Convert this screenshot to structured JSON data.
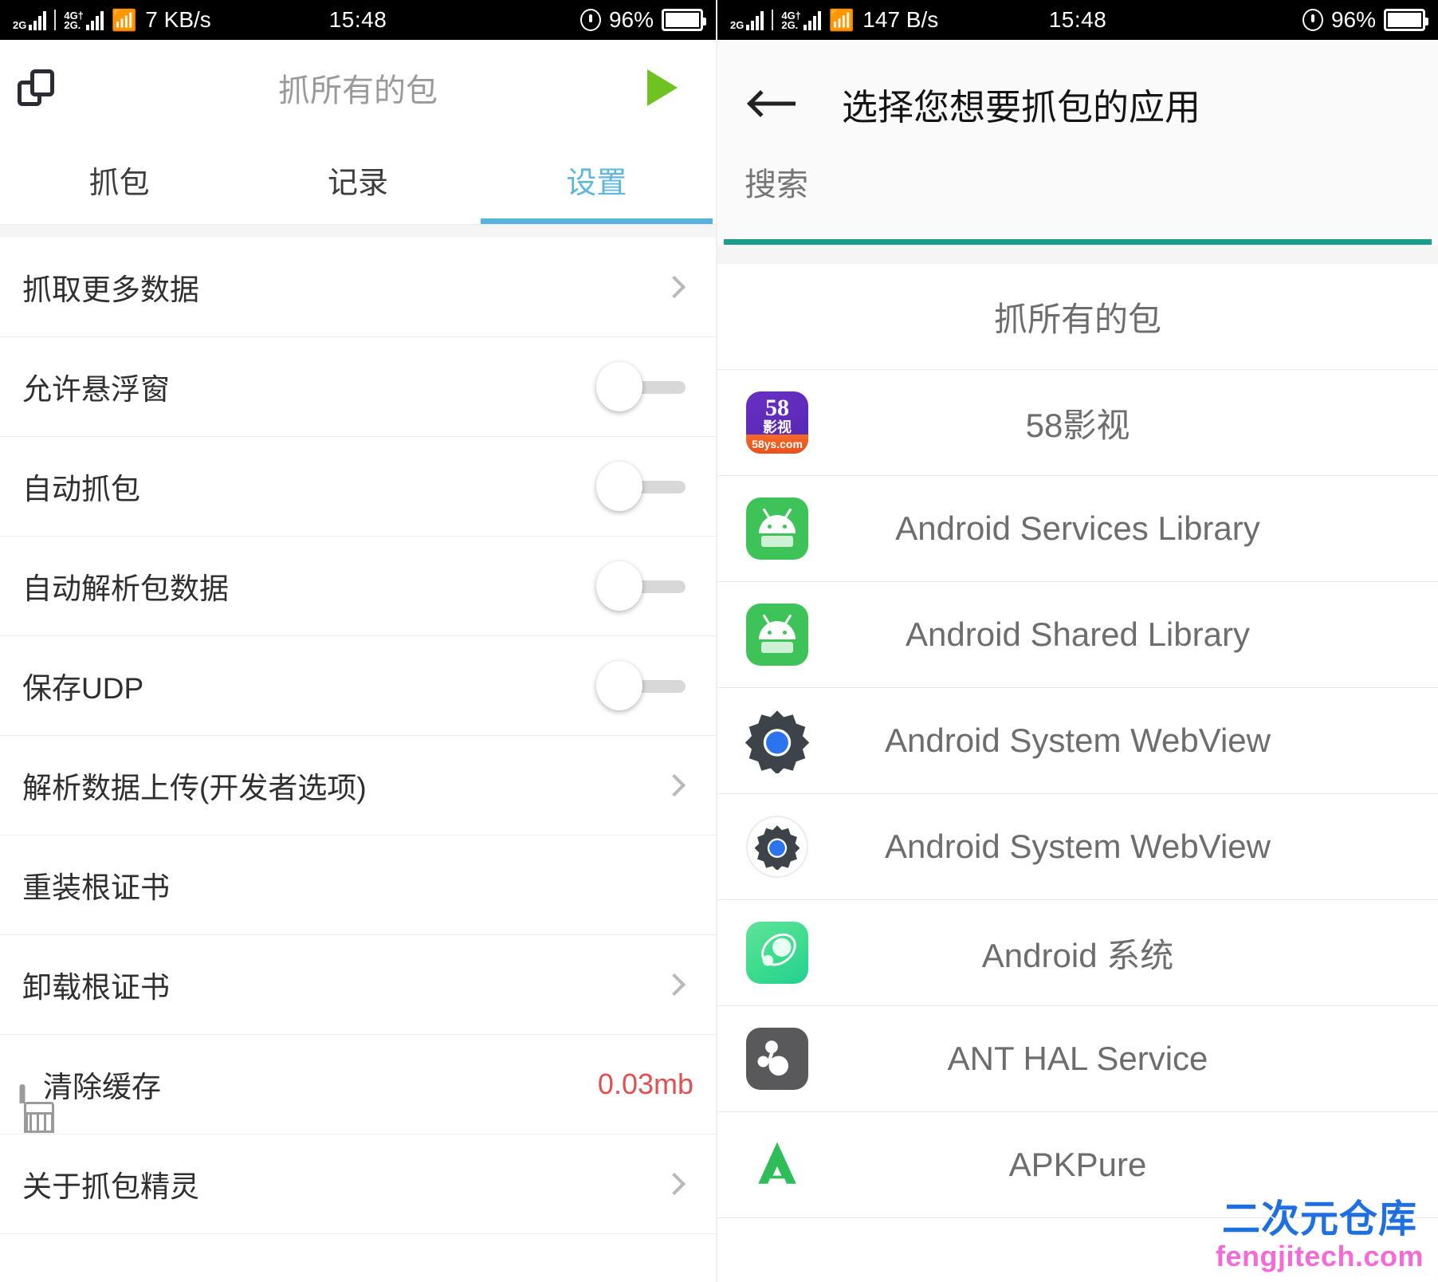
{
  "status_bar": {
    "left": {
      "sim1_label_top": "2G",
      "sim2_label_top": "4G†",
      "sim2_label_bot": "2G.",
      "wifi_icon": "wifi-icon",
      "net_speed": "7 KB/s",
      "time": "15:48",
      "battery_percent": "96%",
      "lock_icon": "rotation-lock-icon"
    },
    "right": {
      "sim1_label_top": "2G",
      "sim2_label_top": "4G†",
      "sim2_label_bot": "2G.",
      "wifi_icon": "wifi-icon",
      "net_speed": "147 B/s",
      "time": "15:48",
      "battery_percent": "96%",
      "lock_icon": "rotation-lock-icon"
    }
  },
  "left_panel": {
    "appbar": {
      "copy_icon": "copy-icon",
      "title": "抓所有的包",
      "play_icon": "play-icon",
      "play_color": "#6ec322"
    },
    "tabs": [
      {
        "label": "抓包",
        "active": false
      },
      {
        "label": "记录",
        "active": false
      },
      {
        "label": "设置",
        "active": true
      }
    ],
    "tab_active_color": "#55b3dd",
    "settings": [
      {
        "label": "抓取更多数据",
        "right": "chevron",
        "icon": null
      },
      {
        "label": "允许悬浮窗",
        "right": "toggle-off",
        "icon": null
      },
      {
        "label": "自动抓包",
        "right": "toggle-off",
        "icon": null
      },
      {
        "label": "自动解析包数据",
        "right": "toggle-off",
        "icon": null
      },
      {
        "label": "保存UDP",
        "right": "toggle-off",
        "icon": null
      },
      {
        "label": "解析数据上传(开发者选项)",
        "right": "chevron",
        "icon": null
      },
      {
        "label": "重装根证书",
        "right": "none",
        "icon": null
      },
      {
        "label": "卸载根证书",
        "right": "chevron",
        "icon": null
      },
      {
        "label": "清除缓存",
        "right": "value",
        "value": "0.03mb",
        "value_color": "#e05050",
        "icon": "brush-icon"
      },
      {
        "label": "关于抓包精灵",
        "right": "chevron",
        "icon": null
      }
    ]
  },
  "right_panel": {
    "appbar": {
      "back_icon": "back-arrow-icon",
      "title": "选择您想要抓包的应用"
    },
    "search": {
      "value": "",
      "placeholder": "搜索",
      "underline_color": "#1a9c88"
    },
    "apps": [
      {
        "name": "抓所有的包",
        "icon": "none"
      },
      {
        "name": "58影视",
        "icon": "app-58ys-icon",
        "icon_text_top": "58",
        "icon_text_mid": "影视",
        "icon_text_bottom": "58ys.com"
      },
      {
        "name": "Android Services Library",
        "icon": "android-droid-icon"
      },
      {
        "name": "Android Shared Library",
        "icon": "android-droid-icon"
      },
      {
        "name": "Android System WebView",
        "icon": "gear-dark-icon"
      },
      {
        "name": "Android System WebView",
        "icon": "gear-circle-icon"
      },
      {
        "name": "Android 系统",
        "icon": "android-system-icon"
      },
      {
        "name": "ANT HAL Service",
        "icon": "ant-hal-icon"
      },
      {
        "name": "APKPure",
        "icon": "apkpure-icon"
      }
    ]
  },
  "watermark": {
    "top": "二次元仓库",
    "bottom": "fengjitech.com",
    "top_color": "#1f6fe0",
    "bottom_color": "#f46ad6"
  }
}
